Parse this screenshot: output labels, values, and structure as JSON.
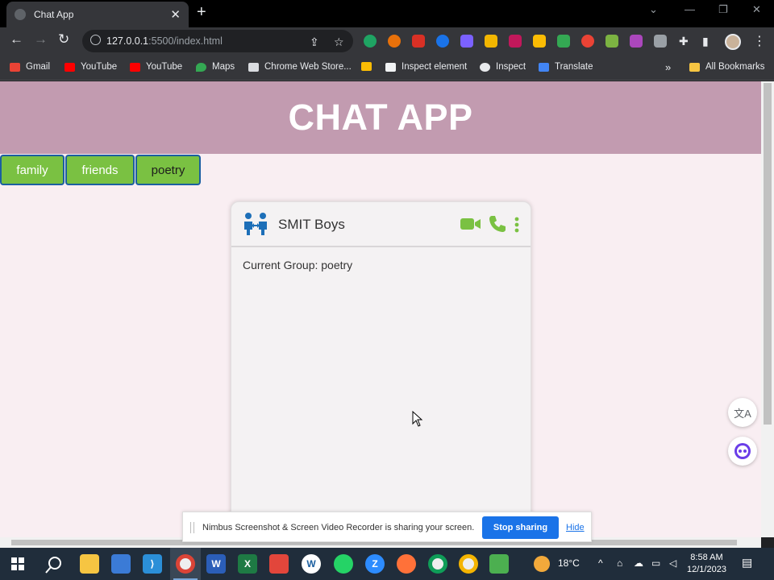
{
  "browser": {
    "tab_title": "Chat App",
    "url_host": "127.0.0.1",
    "url_path": ":5500/index.html",
    "bookmarks": [
      "Gmail",
      "YouTube",
      "YouTube",
      "Maps",
      "Chrome Web Store...",
      "Inspect element",
      "Inspect",
      "Translate"
    ],
    "all_bookmarks": "All Bookmarks"
  },
  "app": {
    "title": "CHAT APP",
    "groups": [
      {
        "label": "family"
      },
      {
        "label": "friends"
      },
      {
        "label": "poetry",
        "active": true
      }
    ],
    "chat": {
      "name": "SMIT Boys",
      "current_group_text": "Current Group: poetry"
    }
  },
  "share_notice": {
    "text": "Nimbus Screenshot & Screen Video Recorder is sharing your screen.",
    "stop_label": "Stop sharing",
    "hide_label": "Hide"
  },
  "taskbar": {
    "weather": "18°C",
    "time": "8:58 AM",
    "date": "12/1/2023"
  },
  "colors": {
    "header": "#c29bb0",
    "page_bg": "#f9eef2",
    "group_btn": "#7ac142",
    "group_btn_border": "#1b5fa0",
    "chat_icons": "#7ac142",
    "group_icon": "#1d6fb8"
  }
}
